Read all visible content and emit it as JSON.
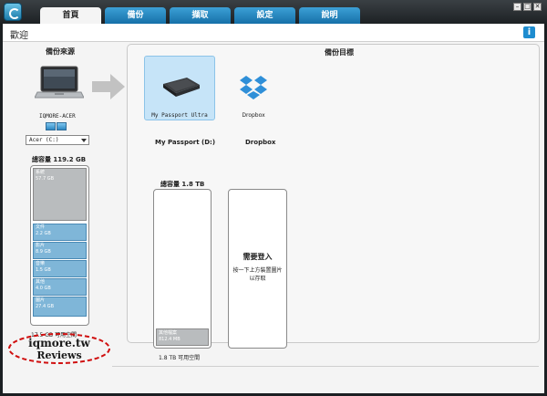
{
  "tabs": [
    {
      "label": "首頁",
      "active": true
    },
    {
      "label": "備份",
      "active": false
    },
    {
      "label": "擷取",
      "active": false
    },
    {
      "label": "設定",
      "active": false
    },
    {
      "label": "說明",
      "active": false
    }
  ],
  "window_controls": {
    "minimize": "–",
    "maximize": "□",
    "close": "✕"
  },
  "header": {
    "title": "歡迎",
    "info_icon": "i"
  },
  "source": {
    "title": "備份來源",
    "computer_name": "IQMORE-ACER",
    "drive_selected": "Acer (C:)",
    "capacity_label": "總容量 119.2 GB",
    "system_segment": {
      "label": "系統",
      "size": "57.7 GB"
    },
    "segments": [
      {
        "label": "文件",
        "size": "2.2 GB"
      },
      {
        "label": "影片",
        "size": "8.9 GB"
      },
      {
        "label": "音樂",
        "size": "1.5 GB"
      },
      {
        "label": "其他",
        "size": "4.0 GB"
      },
      {
        "label": "圖片",
        "size": "27.4 GB"
      }
    ],
    "free_space": "17.5 GB 可用空間"
  },
  "destination": {
    "title": "備份目標",
    "device_card_label": "My Passport Ultra",
    "dropbox_label": "Dropbox",
    "device_name": "My Passport (D:)",
    "dropbox_name": "Dropbox",
    "capacity_label": "總容量 1.8 TB",
    "other_files": {
      "label": "其他檔案",
      "size": "812.4 MB"
    },
    "free_space": "1.8 TB 可用空間",
    "login_title": "需要登入",
    "login_desc": "按一下上方裝置圖片以存取"
  },
  "watermark": {
    "line1": "iqmore.tw",
    "line2": "Reviews"
  },
  "colors": {
    "tab_blue": "#1f86c3",
    "accent": "#1e8ccf",
    "segment_blue": "#7fb6d8",
    "selected_card": "#c6e4f8",
    "watermark_red": "#d01010"
  }
}
